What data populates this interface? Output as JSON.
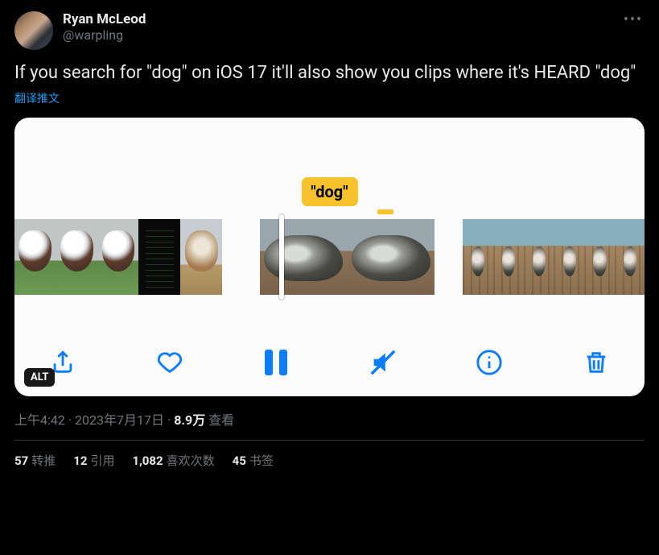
{
  "author": {
    "display_name": "Ryan McLeod",
    "handle": "@warpling"
  },
  "tweet_text": "If you search for \"dog\" on iOS 17 it'll also show you clips where it's HEARD \"dog\"",
  "translate_label": "翻译推文",
  "media": {
    "highlight_label": "\"dog\"",
    "alt_badge": "ALT",
    "toolbar_icons": {
      "share": "share-icon",
      "like": "heart-icon",
      "pause": "pause-icon",
      "mute": "speaker-muted-icon",
      "info": "info-icon",
      "delete": "trash-icon"
    }
  },
  "meta": {
    "time": "上午4:42",
    "date": "2023年7月17日",
    "views_count": "8.9万",
    "views_label": "查看"
  },
  "stats": {
    "retweets": {
      "count": "57",
      "label": "转推"
    },
    "quotes": {
      "count": "12",
      "label": "引用"
    },
    "likes": {
      "count": "1,082",
      "label": "喜欢次数"
    },
    "bookmarks": {
      "count": "45",
      "label": "书签"
    }
  }
}
